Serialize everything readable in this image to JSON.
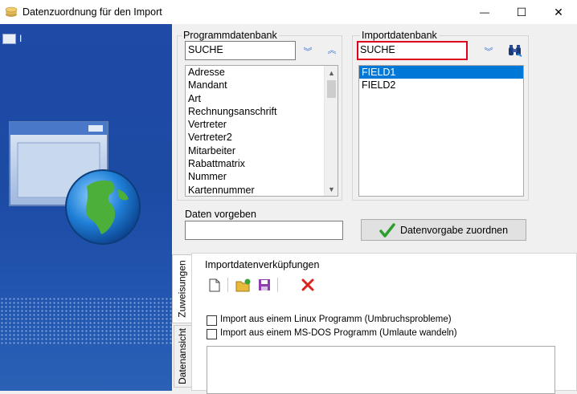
{
  "window": {
    "title": "Datenzuordnung für den Import",
    "minimize_glyph": "—",
    "maximize_glyph": "☐",
    "close_glyph": "✕"
  },
  "left_panel": {
    "caption": "I"
  },
  "program_db": {
    "label": "Programmdatenbank",
    "search_value": "SUCHE",
    "items": [
      "Adresse",
      "Mandant",
      "Art",
      "Rechnungsanschrift",
      "Vertreter",
      "Vertreter2",
      "Mitarbeiter",
      "Rabattmatrix",
      "Nummer",
      "Kartennummer"
    ]
  },
  "import_db": {
    "label": "Importdatenbank",
    "search_value": "SUCHE",
    "items": [
      "FIELD1",
      "FIELD2"
    ],
    "selected_index": 0
  },
  "defaults": {
    "label": "Daten vorgeben",
    "value": "",
    "assign_button": "Datenvorgabe zuordnen"
  },
  "tabs": [
    "Zuweisungen",
    "Datenansicht"
  ],
  "import_links": {
    "title": "Importdatenverküpfungen",
    "checkbox_linux": "Import aus einem Linux Programm (Umbruchsprobleme)",
    "checkbox_dos": "Import aus einem MS-DOS Programm (Umlaute wandeln)"
  },
  "colors": {
    "selection": "#0078d7",
    "highlight_border": "#e0001b",
    "panel_blue": "#1f4aa6"
  }
}
